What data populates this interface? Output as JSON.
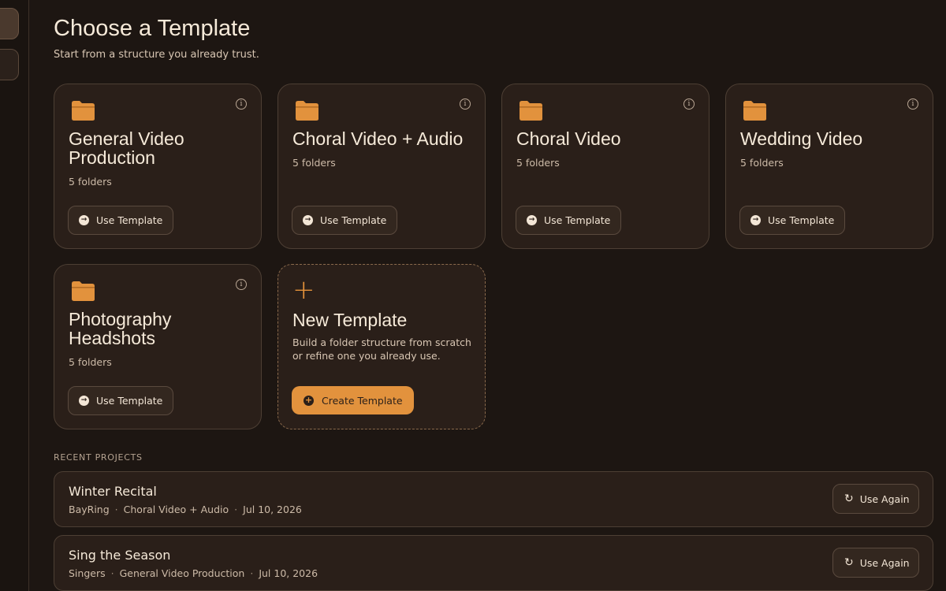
{
  "header": {
    "title": "Choose a Template",
    "subtitle": "Start from a structure you already trust."
  },
  "templates": [
    {
      "title": "General Video Production",
      "count": "5 folders",
      "button": "Use Template"
    },
    {
      "title": "Choral Video + Audio",
      "count": "5 folders",
      "button": "Use Template"
    },
    {
      "title": "Choral Video",
      "count": "5 folders",
      "button": "Use Template"
    },
    {
      "title": "Wedding Video",
      "count": "5 folders",
      "button": "Use Template"
    },
    {
      "title": "Photography Headshots",
      "count": "5 folders",
      "button": "Use Template"
    }
  ],
  "new_template": {
    "title": "New Template",
    "description": "Build a folder structure from scratch or refine one you already use.",
    "button": "Create Template"
  },
  "recent": {
    "label": "RECENT PROJECTS",
    "items": [
      {
        "name": "Winter Recital",
        "client": "BayRing",
        "template": "Choral Video + Audio",
        "date": "Jul 10, 2026",
        "button": "Use Again"
      },
      {
        "name": "Sing the Season",
        "client": "Singers",
        "template": "General Video Production",
        "date": "Jul 10, 2026",
        "button": "Use Again"
      }
    ]
  },
  "icons": {
    "folder": "folder-icon",
    "info": "info-icon",
    "arrow": "arrow-right-circle-icon",
    "plus": "plus-icon",
    "refresh": "refresh-icon"
  },
  "colors": {
    "background": "#1d1612",
    "card": "#2a1f19",
    "accent": "#e2923d",
    "text": "#f6ead9"
  }
}
